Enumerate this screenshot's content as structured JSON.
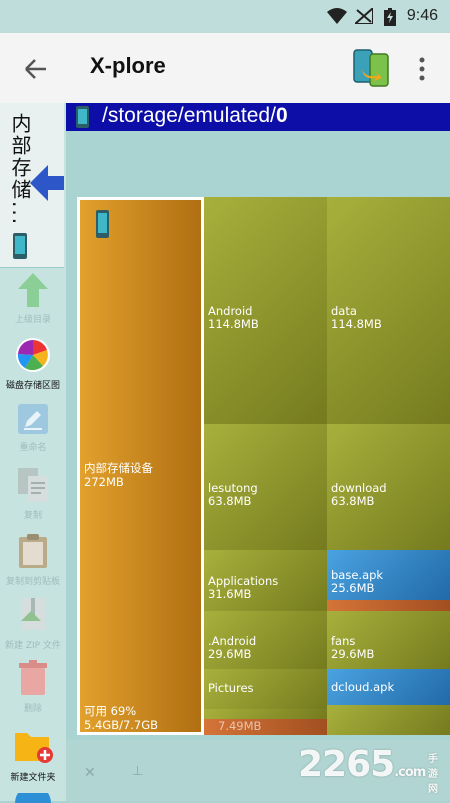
{
  "status": {
    "time": "9:46"
  },
  "toolbar": {
    "title": "X-plore"
  },
  "sidebar": {
    "storage_label": "内部存储...",
    "tools": [
      {
        "label": "上级目录"
      },
      {
        "label": "磁盘存储区图"
      },
      {
        "label": "重命名"
      },
      {
        "label": "复制"
      },
      {
        "label": "复制到剪贴板"
      },
      {
        "label": "新建 ZIP 文件"
      },
      {
        "label": "删除"
      },
      {
        "label": "新建文件夹"
      }
    ]
  },
  "path": {
    "prefix": "/storage/emulated/",
    "last": "0"
  },
  "map": {
    "root": {
      "name": "内部存储设备",
      "size": "272MB",
      "free_label": "可用 69%",
      "free_size": "5.4GB/7.7GB"
    },
    "items": [
      {
        "name": "Android",
        "size": "114.8MB"
      },
      {
        "name": "data",
        "size": "114.8MB"
      },
      {
        "name": "lesutong",
        "size": "63.8MB"
      },
      {
        "name": "download",
        "size": "63.8MB"
      },
      {
        "name": "Applications",
        "size": "31.6MB"
      },
      {
        "name": "base.apk",
        "size": "25.6MB"
      },
      {
        "name": ".Android",
        "size": "29.6MB"
      },
      {
        "name": "fans",
        "size": "29.6MB"
      },
      {
        "name": "Pictures",
        "size": ""
      },
      {
        "name": "dcloud.apk",
        "size": ""
      },
      {
        "name": "",
        "size": "7.49MB"
      }
    ],
    "colors": {
      "folder": "#9aa236",
      "apk": "#3d8fd6",
      "root": "#c9841c"
    }
  },
  "watermark": {
    "main": "2265",
    "sub": ".com",
    "tag": "手游网"
  }
}
